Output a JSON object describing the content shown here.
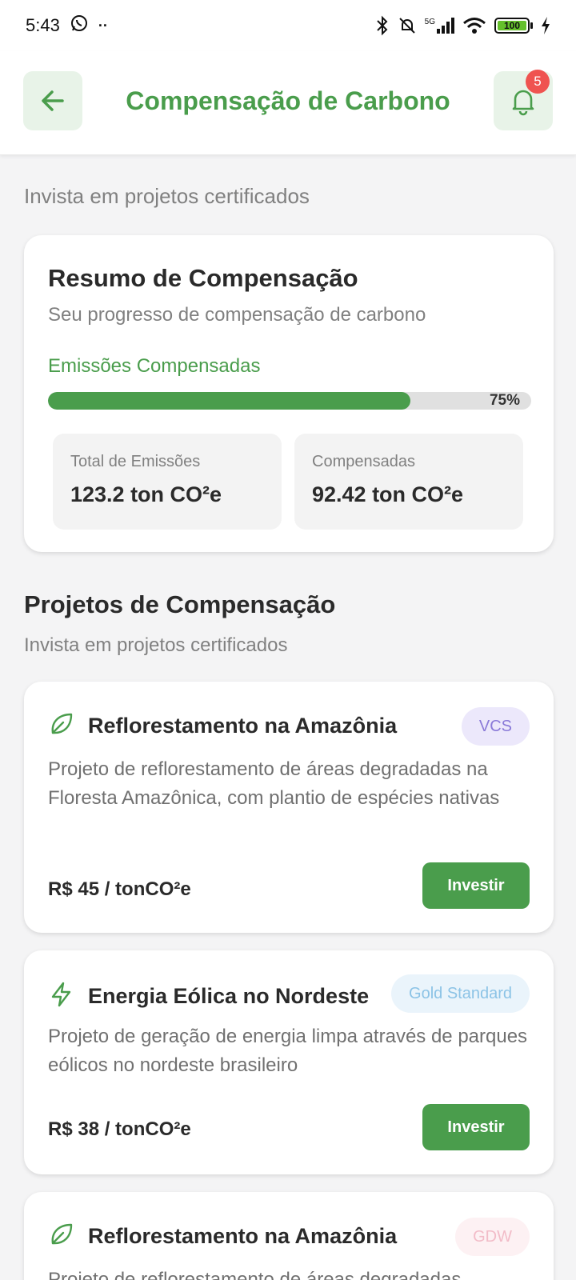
{
  "status_bar": {
    "time": "5:43",
    "network": "5G",
    "battery": "100"
  },
  "header": {
    "title": "Compensação de Carbono",
    "notification_count": "5"
  },
  "intro_subtitle": "Invista em projetos certificados",
  "summary": {
    "title": "Resumo de Compensação",
    "description": "Seu progresso de compensação de carbono",
    "progress_label": "Emissões Compensadas",
    "progress_percent": 75,
    "progress_text": "75%",
    "total_label": "Total de Emissões",
    "total_value": "123.2 ton CO²e",
    "compensated_label": "Compensadas",
    "compensated_value": "92.42 ton CO²e"
  },
  "projects_section": {
    "title": "Projetos de Compensação",
    "subtitle": "Invista em projetos certificados"
  },
  "projects": [
    {
      "icon": "leaf-icon",
      "name": "Reflorestamento na Amazônia",
      "tag": "VCS",
      "description": "Projeto de reflorestamento de áreas degradadas na Floresta Amazônica, com plantio de espécies nativas",
      "price": "R$ 45 / tonCO²e",
      "button": "Investir"
    },
    {
      "icon": "lightning-icon",
      "name": "Energia Eólica no Nordeste",
      "tag": "Gold Standard",
      "description": "Projeto de geração de energia limpa através de parques eólicos no nordeste brasileiro",
      "price": "R$ 38 / tonCO²e",
      "button": "Investir"
    },
    {
      "icon": "leaf-icon",
      "name": "Reflorestamento na Amazônia",
      "tag": "GDW",
      "description": "Projeto de reflorestamento de áreas degradadas"
    }
  ],
  "colors": {
    "primary_green": "#4a9d4c",
    "light_green": "#e8f3e8",
    "badge_red": "#ef5350"
  }
}
